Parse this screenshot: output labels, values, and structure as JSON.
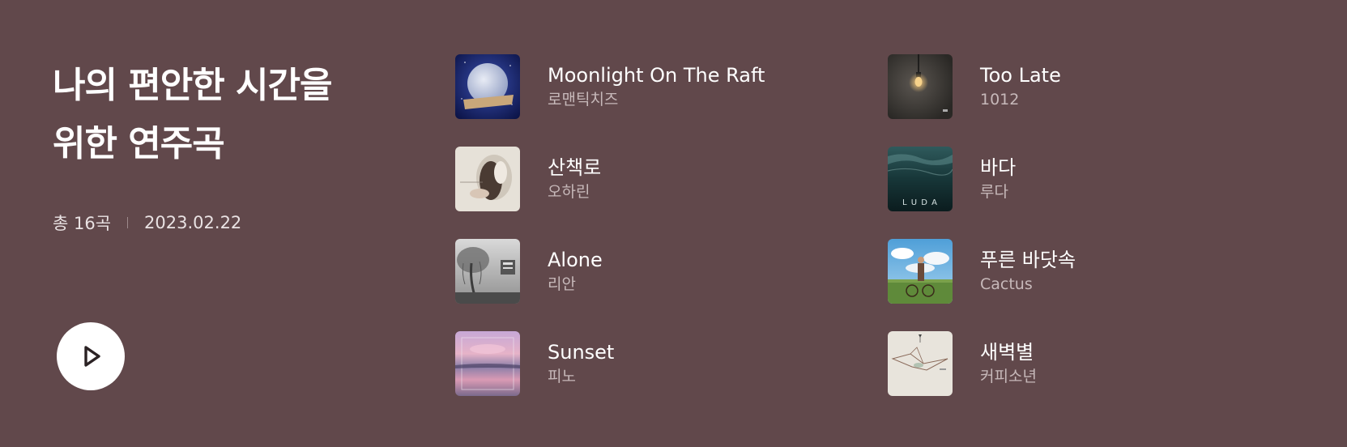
{
  "playlist": {
    "title_line1": "나의 편안한 시간을",
    "title_line2": "위한 연주곡",
    "track_count": "총 16곡",
    "date": "2023.02.22",
    "play_icon": "play-icon"
  },
  "tracks": [
    {
      "title": "Moonlight On The Raft",
      "artist": "로맨틱치즈",
      "cover": "moon-album-cover"
    },
    {
      "title": "Too Late",
      "artist": "1012",
      "cover": "lightbulb-album-cover"
    },
    {
      "title": "산책로",
      "artist": "오하린",
      "cover": "embrace-album-cover"
    },
    {
      "title": "바다",
      "artist": "루다",
      "cover": "underwater-album-cover",
      "cover_text": "L U D A"
    },
    {
      "title": "Alone",
      "artist": "리안",
      "cover": "tree-album-cover"
    },
    {
      "title": "푸른 바닷속",
      "artist": "Cactus",
      "cover": "bicycle-album-cover"
    },
    {
      "title": "Sunset",
      "artist": "피노",
      "cover": "sunset-album-cover"
    },
    {
      "title": "새벽별",
      "artist": "커피소년",
      "cover": "sketch-album-cover"
    }
  ],
  "colors": {
    "background": "#61484b",
    "text_primary": "#ffffff",
    "text_secondary": "#c7b9ba"
  }
}
